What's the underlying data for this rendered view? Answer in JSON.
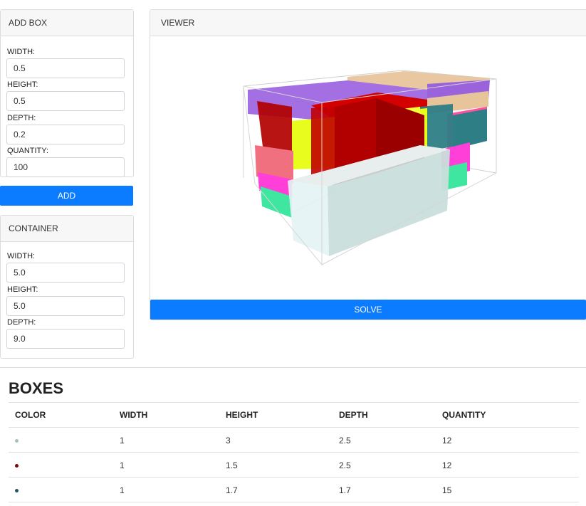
{
  "add_box": {
    "title": "ADD BOX",
    "width_label": "WIDTH:",
    "width_value": "0.5",
    "height_label": "HEIGHT:",
    "height_value": "0.5",
    "depth_label": "DEPTH:",
    "depth_value": "0.2",
    "quantity_label": "QUANTITY:",
    "quantity_value": "100",
    "add_label": "ADD"
  },
  "container": {
    "title": "CONTAINER",
    "width_label": "WIDTH:",
    "width_value": "5.0",
    "height_label": "HEIGHT:",
    "height_value": "5.0",
    "depth_label": "DEPTH:",
    "depth_value": "9.0"
  },
  "viewer": {
    "title": "VIEWER",
    "solve_label": "SOLVE",
    "box_colors": [
      "#a46fe3",
      "#b20000",
      "#e8fc1d",
      "#e8c49b",
      "#2e7e86",
      "#ff4fa0",
      "#3fe6a0",
      "#f07080",
      "#ff3fd8",
      "#cfe3e3"
    ]
  },
  "boxes": {
    "title": "BOXES",
    "headers": [
      "COLOR",
      "WIDTH",
      "HEIGHT",
      "DEPTH",
      "QUANTITY"
    ],
    "rows": [
      {
        "color": "#a3c3bf",
        "width": "1",
        "height": "3",
        "depth": "2.5",
        "quantity": "12"
      },
      {
        "color": "#7a0a0a",
        "width": "1",
        "height": "1.5",
        "depth": "2.5",
        "quantity": "12"
      },
      {
        "color": "#24575e",
        "width": "1",
        "height": "1.7",
        "depth": "1.7",
        "quantity": "15"
      }
    ]
  }
}
